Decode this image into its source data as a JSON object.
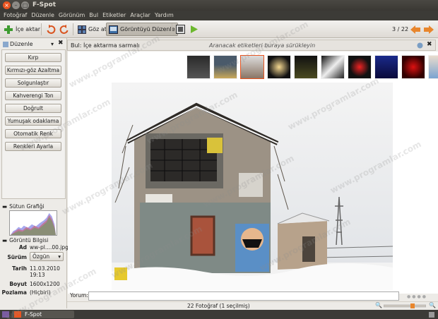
{
  "window": {
    "title": "F-Spot"
  },
  "menubar": [
    "Fotoğraf",
    "Düzenle",
    "Görünüm",
    "Bul",
    "Etiketler",
    "Araçlar",
    "Yardım"
  ],
  "toolbar": {
    "import": "İçe aktar",
    "browse": "Göz at",
    "edit_view": "Görüntüyü Düzenle",
    "counter": "3 / 22"
  },
  "findbar": {
    "label": "Bul:",
    "query": "İçe aktarma sarmalı",
    "hint": "Aranacak etiketleri buraya sürükleyin"
  },
  "sidebar": {
    "selector": "Düzenle",
    "edit_buttons": [
      "Kırp",
      "Kırmızı-göz Azaltma",
      "Solgunlaştır",
      "Kahverengi Ton",
      "Doğrult",
      "Yumuşak odaklama",
      "Otomatik Renk",
      "Renkleri Ayarla"
    ],
    "histogram_title": "Sütun Grafiği",
    "info_title": "Görüntü Bilgisi",
    "info": {
      "name_label": "Ad",
      "name_value": "ww-pl....00.jpg",
      "version_label": "Sürüm",
      "version_value": "Özgün",
      "date_label": "Tarih",
      "date_value": "11.03.2010",
      "time_value": "19:13",
      "size_label": "Boyut",
      "size_value": "1600x1200",
      "exposure_label": "Pozlama",
      "exposure_value": "(Hiçbiri)"
    }
  },
  "main": {
    "comment_label": "Yorum:",
    "status": "22 Fotoğraf (1 seçilmiş)"
  },
  "taskbar": {
    "item": "F-Spot"
  },
  "watermark": "www.programlar.com",
  "colors": {
    "accent": "#e95420",
    "titlebar": "#3c3b37"
  }
}
